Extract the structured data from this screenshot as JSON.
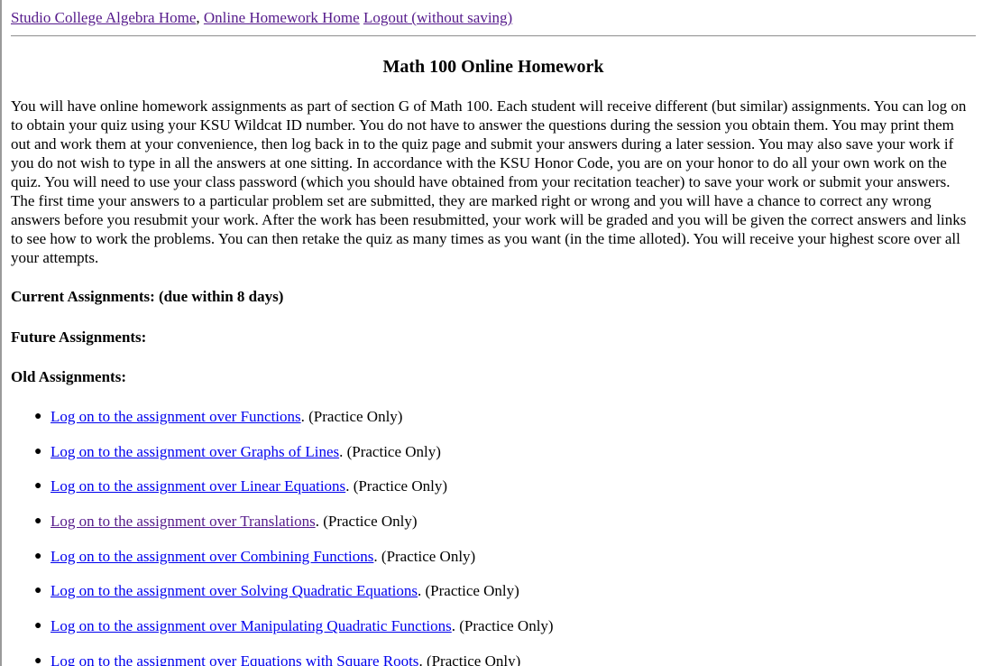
{
  "nav": {
    "links": [
      {
        "label": "Studio College Algebra Home",
        "sep": ", ",
        "visited": true
      },
      {
        "label": "Online Homework Home",
        "sep": " ",
        "visited": true
      },
      {
        "label": "Logout (without saving)",
        "sep": "",
        "visited": true
      }
    ]
  },
  "page": {
    "title": "Math 100 Online Homework",
    "intro": "You will have online homework assignments as part of section G of Math 100. Each student will receive different (but similar) assignments. You can log on to obtain your quiz using your KSU Wildcat ID number. You do not have to answer the questions during the session you obtain them. You may print them out and work them at your convenience, then log back in to the quiz page and submit your answers during a later session. You may also save your work if you do not wish to type in all the answers at one sitting. In accordance with the KSU Honor Code, you are on your honor to do all your own work on the quiz. You will need to use your class password (which you should have obtained from your recitation teacher) to save your work or submit your answers. The first time your answers to a particular problem set are submitted, they are marked right or wrong and you will have a chance to correct any wrong answers before you resubmit your work. After the work has been resubmitted, your work will be graded and you will be given the correct answers and links to see how to work the problems. You can then retake the quiz as many times as you want (in the time alloted). You will receive your highest score over all your attempts."
  },
  "sections": {
    "current": "Current Assignments: (due within 8 days)",
    "future": "Future Assignments:",
    "old": "Old Assignments:"
  },
  "old_assignments": [
    {
      "link": "Log on to the assignment over Functions",
      "note": ". (Practice Only)",
      "visited": false
    },
    {
      "link": "Log on to the assignment over Graphs of Lines",
      "note": ". (Practice Only)",
      "visited": false
    },
    {
      "link": "Log on to the assignment over Linear Equations",
      "note": ". (Practice Only)",
      "visited": false
    },
    {
      "link": "Log on to the assignment over Translations",
      "note": ". (Practice Only)",
      "visited": true
    },
    {
      "link": "Log on to the assignment over Combining Functions",
      "note": ". (Practice Only)",
      "visited": false
    },
    {
      "link": "Log on to the assignment over Solving Quadratic Equations",
      "note": ". (Practice Only)",
      "visited": false
    },
    {
      "link": "Log on to the assignment over Manipulating Quadratic Functions",
      "note": ". (Practice Only)",
      "visited": false
    },
    {
      "link": "Log on to the assignment over Equations with Square Roots",
      "note": ". (Practice Only)",
      "visited": false
    }
  ],
  "colors": {
    "link": "#0000ee",
    "visited_link": "#551a8b",
    "text": "#000000",
    "background": "#ffffff"
  }
}
